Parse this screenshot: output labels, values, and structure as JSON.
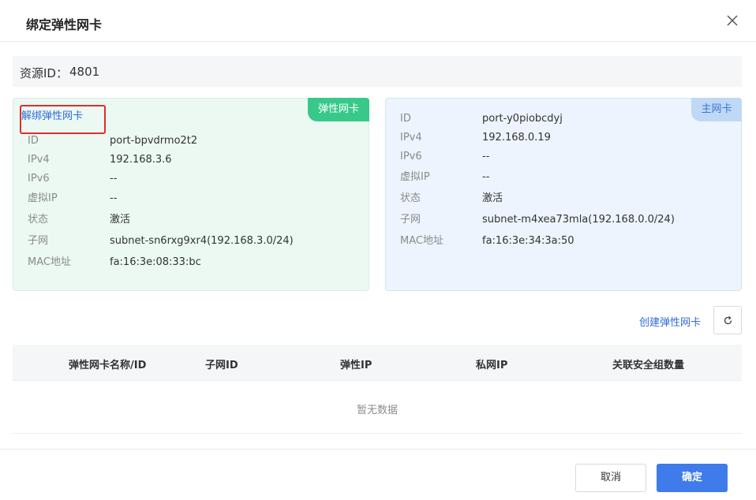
{
  "dialog": {
    "title": "绑定弹性网卡"
  },
  "resource": {
    "label": "资源ID：",
    "value": "4801"
  },
  "elastic_card": {
    "badge": "弹性网卡",
    "unbind_label": "解绑弹性网卡",
    "fields": [
      {
        "label": "ID",
        "value": "port-bpvdrmo2t2"
      },
      {
        "label": "IPv4",
        "value": "192.168.3.6"
      },
      {
        "label": "IPv6",
        "value": "--"
      },
      {
        "label": "虚拟IP",
        "value": "--"
      },
      {
        "label": "状态",
        "value": "激活"
      },
      {
        "label": "子网",
        "value": "subnet-sn6rxg9xr4(192.168.3.0/24)"
      },
      {
        "label": "MAC地址",
        "value": "fa:16:3e:08:33:bc"
      }
    ]
  },
  "primary_card": {
    "badge": "主网卡",
    "fields": [
      {
        "label": "ID",
        "value": "port-y0piobcdyj"
      },
      {
        "label": "IPv4",
        "value": "192.168.0.19"
      },
      {
        "label": "IPv6",
        "value": "--"
      },
      {
        "label": "虚拟IP",
        "value": "--"
      },
      {
        "label": "状态",
        "value": "激活"
      },
      {
        "label": "子网",
        "value": "subnet-m4xea73mla(192.168.0.0/24)"
      },
      {
        "label": "MAC地址",
        "value": "fa:16:3e:34:3a:50"
      }
    ]
  },
  "toolbar": {
    "create_label": "创建弹性网卡",
    "refresh_icon": "refresh-icon"
  },
  "table": {
    "columns": [
      "弹性网卡名称/ID",
      "子网ID",
      "弹性IP",
      "私网IP",
      "关联安全组数量"
    ],
    "empty_text": "暂无数据"
  },
  "footer": {
    "cancel_label": "取消",
    "ok_label": "确定"
  },
  "colors": {
    "accent": "#3f7bea",
    "green_badge": "#38c98a",
    "highlight": "#e02d2d"
  }
}
